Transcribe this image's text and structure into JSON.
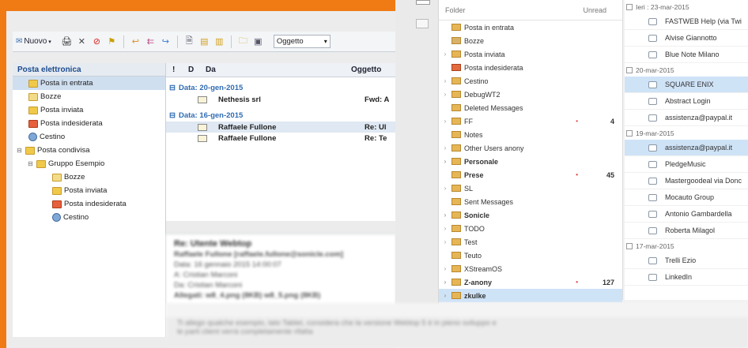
{
  "left": {
    "toolbar": {
      "new_label": "Nuovo",
      "search_field": "Oggetto"
    },
    "folders_title": "Posta elettronica",
    "folders": [
      {
        "label": "Posta in entrata",
        "icon": "inbox-folder-icon",
        "selected": true
      },
      {
        "label": "Bozze",
        "icon": "drafts-icon"
      },
      {
        "label": "Posta inviata",
        "icon": "sent-icon"
      },
      {
        "label": "Posta indesiderata",
        "icon": "junk-icon"
      },
      {
        "label": "Cestino",
        "icon": "trash-icon"
      }
    ],
    "shared": {
      "label": "Posta condivisa",
      "group": "Gruppo Esempio",
      "subfolders": [
        "Bozze",
        "Posta inviata",
        "Posta indesiderata",
        "Cestino"
      ]
    },
    "columns": {
      "flag": "!",
      "attachment": "D",
      "from": "Da",
      "subject": "Oggetto"
    },
    "groups": [
      {
        "label": "Data: 20-gen-2015",
        "rows": [
          {
            "from": "Nethesis srl",
            "subject": "Fwd: A"
          }
        ]
      },
      {
        "label": "Data: 16-gen-2015",
        "rows": [
          {
            "from": "Raffaele Fullone",
            "subject": "Re: Ul",
            "selected": true
          },
          {
            "from": "Raffaele Fullone",
            "subject": "Re: Te"
          }
        ]
      }
    ],
    "preview": {
      "title": "Re: Utente Webtop",
      "from": "Raffaele Fullone [raffaele.fullone@sonicle.com]",
      "lines": [
        "Data: 16 gennaio 2015 14:00:07",
        "A: Cristian Marconi",
        "Da: Cristian Marconi",
        "Allegati: w8_4.png (8KB) w8_5.png (8KB)"
      ]
    }
  },
  "right": {
    "header": {
      "folder": "Folder",
      "unread": "Unread"
    },
    "folders": [
      {
        "label": "Posta in entrata",
        "icon": "inbox-icon"
      },
      {
        "label": "Bozze",
        "icon": "drafts-icon"
      },
      {
        "label": "Posta inviata",
        "icon": "sent-icon",
        "arrow": true
      },
      {
        "label": "Posta indesiderata",
        "icon": "junk-icon"
      },
      {
        "label": "Cestino",
        "icon": "trash-icon",
        "arrow": true
      },
      {
        "label": "DebugWT2",
        "arrow": true
      },
      {
        "label": "Deleted Messages"
      },
      {
        "label": "FF",
        "arrow": true,
        "count": "4",
        "dot": true
      },
      {
        "label": "Notes"
      },
      {
        "label": "Other Users anony",
        "arrow": true
      },
      {
        "label": "Personale",
        "arrow": true,
        "bold": true
      },
      {
        "label": "Prese",
        "bold": true,
        "count": "45",
        "dot": true
      },
      {
        "label": "SL",
        "arrow": true
      },
      {
        "label": "Sent Messages"
      },
      {
        "label": "Sonicle",
        "arrow": true,
        "bold": true
      },
      {
        "label": "TODO",
        "arrow": true
      },
      {
        "label": "Test",
        "arrow": true
      },
      {
        "label": "Teuto"
      },
      {
        "label": "XStreamOS",
        "arrow": true
      },
      {
        "label": "Z-anony",
        "arrow": true,
        "bold": true,
        "count": "127",
        "dot": true
      },
      {
        "label": "zkulke",
        "arrow": true,
        "bold": true,
        "selected": true
      }
    ],
    "mail": [
      {
        "group": "Ieri : 23-mar-2015"
      },
      {
        "sender": "FASTWEB Help (via Twi"
      },
      {
        "sender": "Alvise Giannotto"
      },
      {
        "sender": "Blue Note Milano"
      },
      {
        "group": "20-mar-2015"
      },
      {
        "sender": "SQUARE ENIX",
        "selected": true
      },
      {
        "sender": "Abstract Login"
      },
      {
        "sender": "assistenza@paypal.it"
      },
      {
        "group": "19-mar-2015"
      },
      {
        "sender": "assistenza@paypal.it",
        "selected": true
      },
      {
        "sender": "PledgeMusic"
      },
      {
        "sender": "Mastergoodeal via Donc"
      },
      {
        "sender": "Mocauto Group"
      },
      {
        "sender": "Antonio Gambardella"
      },
      {
        "sender": "Roberta Milagol"
      },
      {
        "group": "17-mar-2015"
      },
      {
        "sender": "Trelli Ezio"
      },
      {
        "sender": "LinkedIn"
      }
    ]
  },
  "bottom_text": {
    "line1": "Ti allego qualche esempio, lato Tablet, considera che la versione Webtop 5 è in pieno sviluppo e",
    "line2": "le parti client verrà completamente rifatta"
  }
}
